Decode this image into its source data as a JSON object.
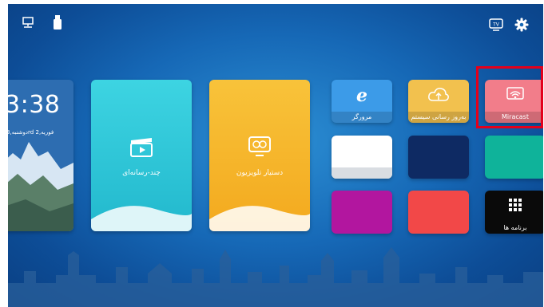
{
  "clock": {
    "time": "3:38",
    "date": "دوشنبه,3rd فوریه,2"
  },
  "top_left_icons": [
    "monitor-icon",
    "usb-drive-icon"
  ],
  "top_right_icons": [
    "tv-input-icon",
    "gear-icon"
  ],
  "large_tiles": [
    {
      "label": "چند-رسانه‌ای",
      "icon": "film-clapper-icon"
    },
    {
      "label": "دستیار تلویزیون",
      "icon": "tv-assistant-icon"
    }
  ],
  "small_tiles": [
    {
      "label": "مرورگر",
      "icon": "browser-e-icon"
    },
    {
      "label": "به‌روز رسانی سیستم",
      "icon": "cloud-upload-icon"
    },
    {
      "label": "Miracast",
      "icon": "cast-icon"
    },
    {
      "label": "",
      "icon": ""
    },
    {
      "label": "",
      "icon": ""
    },
    {
      "label": "",
      "icon": ""
    },
    {
      "label": "",
      "icon": ""
    },
    {
      "label": "",
      "icon": ""
    },
    {
      "label": "برنامه ها",
      "icon": "apps-grid-icon"
    }
  ],
  "colors": {
    "background": "#1668b6",
    "media_tile": "#2ec7d8",
    "assistant_tile": "#f6b62b",
    "browser_tile": "#3c9be8",
    "update_tile": "#f2c14e",
    "miracast_tile": "#f27d8a",
    "white_tile": "#ffffff",
    "navy_tile": "#0e2a63",
    "teal_tile": "#0fb39a",
    "magenta_tile": "#b2169f",
    "red_tile": "#f24848",
    "apps_tile": "#0a0a0a",
    "highlight": "#e3001b"
  }
}
